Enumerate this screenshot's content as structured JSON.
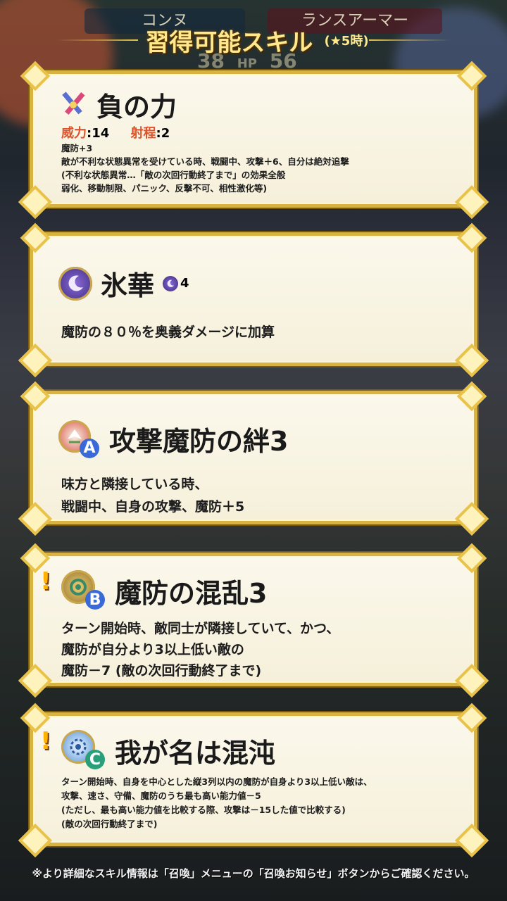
{
  "top": {
    "unit_left": "コンヌ",
    "unit_right": "ランスアーマー",
    "hp_left": "38",
    "hp_label": "HP",
    "hp_right": "56"
  },
  "banner": {
    "title": "習得可能スキル",
    "subtitle": "(★5時)"
  },
  "skills": [
    {
      "icon": "weapon-swords-icon",
      "name": "負の力",
      "might_label": "威力",
      "might_value": ":14",
      "range_label": "射程",
      "range_value": ":2",
      "lines": [
        "魔防+3",
        "敵が不利な状態異常を受けている時、戦闘中、攻撃＋6、自分は絶対追撃",
        "(不利な状態異常…「敵の次回行動終了まで」の効果全般",
        "弱化、移動制限、パニック、反撃不可、相性激化等)"
      ]
    },
    {
      "icon": "special-moon-icon",
      "name": "氷華",
      "cooldown": "4",
      "lines": [
        "魔防の８０％を奥義ダメージに加算"
      ]
    },
    {
      "icon": "passive-a-icon",
      "name": "攻撃魔防の絆3",
      "slot": "A",
      "lines": [
        "味方と隣接している時、",
        "戦闘中、自身の攻撃、魔防＋5"
      ]
    },
    {
      "icon": "passive-b-icon",
      "name": "魔防の混乱3",
      "slot": "B",
      "alert": "!",
      "lines": [
        "ターン開始時、敵同士が隣接していて、かつ、",
        "魔防が自分より3以上低い敵の",
        "魔防－7 (敵の次回行動終了まで)"
      ]
    },
    {
      "icon": "passive-c-icon",
      "name": "我が名は混沌",
      "slot": "C",
      "alert": "!",
      "lines": [
        "ターン開始時、自身を中心とした縦3列以内の魔防が自身より3以上低い敵は、",
        "攻撃、速さ、守備、魔防のうち最も高い能力値－5",
        "(ただし、最も高い能力値を比較する際、攻撃は－15した値で比較する)",
        "(敵の次回行動終了まで)"
      ]
    }
  ],
  "footer": {
    "note": "※より詳細なスキル情報は「召喚」メニューの「召喚お知らせ」ボタンからご確認ください。"
  },
  "colors": {
    "gold": "#d8b341",
    "card_bg": "#fbf8ec",
    "stat_label": "#e0532a",
    "title": "#ffe98c"
  }
}
